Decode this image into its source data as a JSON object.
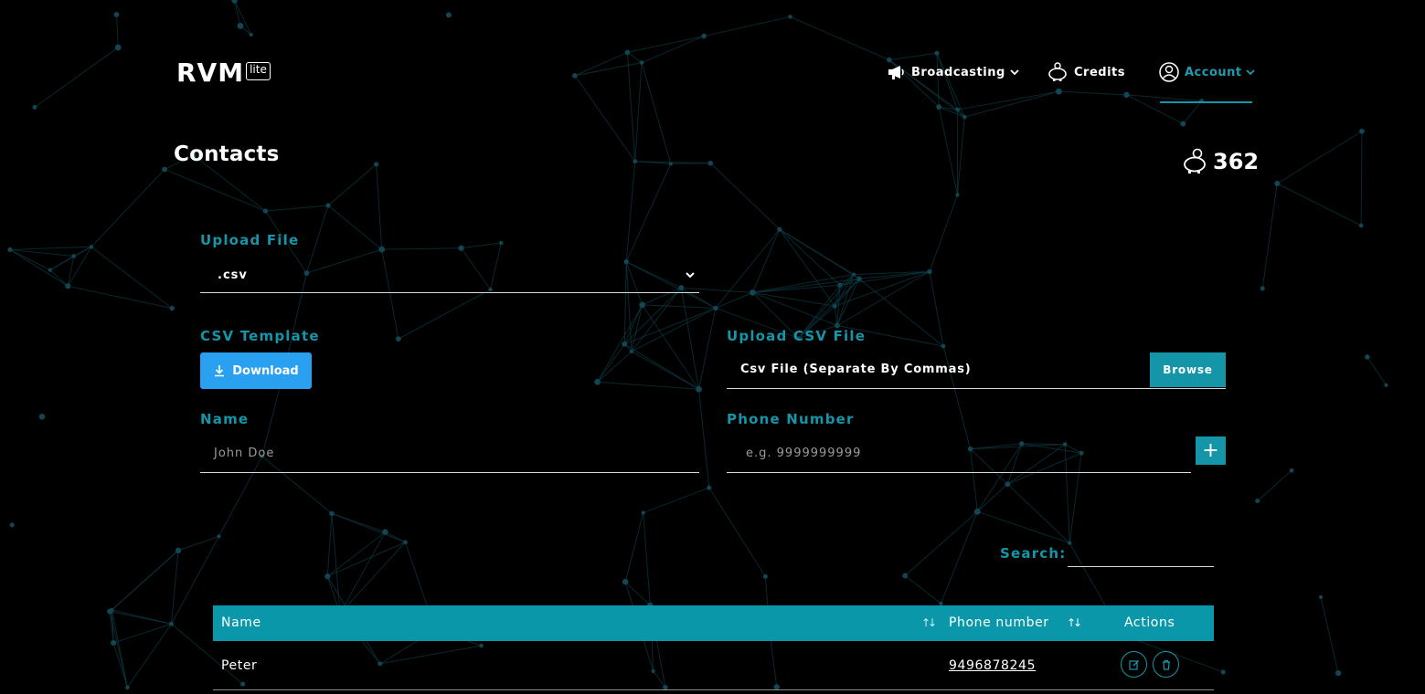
{
  "brand": {
    "logo_text": "RVM",
    "logo_badge": "lite"
  },
  "nav": {
    "broadcasting": "Broadcasting",
    "credits": "Credits",
    "account": "Account"
  },
  "page": {
    "title": "Contacts",
    "credit_balance": "362"
  },
  "form": {
    "upload_file_label": "Upload File",
    "upload_file_selected": ".csv",
    "csv_template_label": "CSV Template",
    "download_label": "Download",
    "upload_csv_label": "Upload CSV File",
    "csv_file_placeholder": "Csv File (Separate By Commas)",
    "browse_label": "Browse",
    "name_label": "Name",
    "name_placeholder": "John Doe",
    "phone_label": "Phone Number",
    "phone_placeholder": "e.g. 9999999999",
    "add_label": "+"
  },
  "table": {
    "search_label": "Search:",
    "search_value": "",
    "columns": [
      "Name",
      "Phone number",
      "Actions"
    ],
    "rows": [
      {
        "name": "Peter",
        "phone": "9496878245"
      }
    ]
  },
  "colors": {
    "accent": "#1596a8",
    "download_button": "#2aa0f0",
    "background": "#000000"
  },
  "icons": [
    "megaphone-icon",
    "piggy-bank-icon",
    "account-icon",
    "chevron-down-icon",
    "download-icon",
    "plus-icon",
    "sort-icon",
    "edit-icon",
    "trash-icon"
  ]
}
